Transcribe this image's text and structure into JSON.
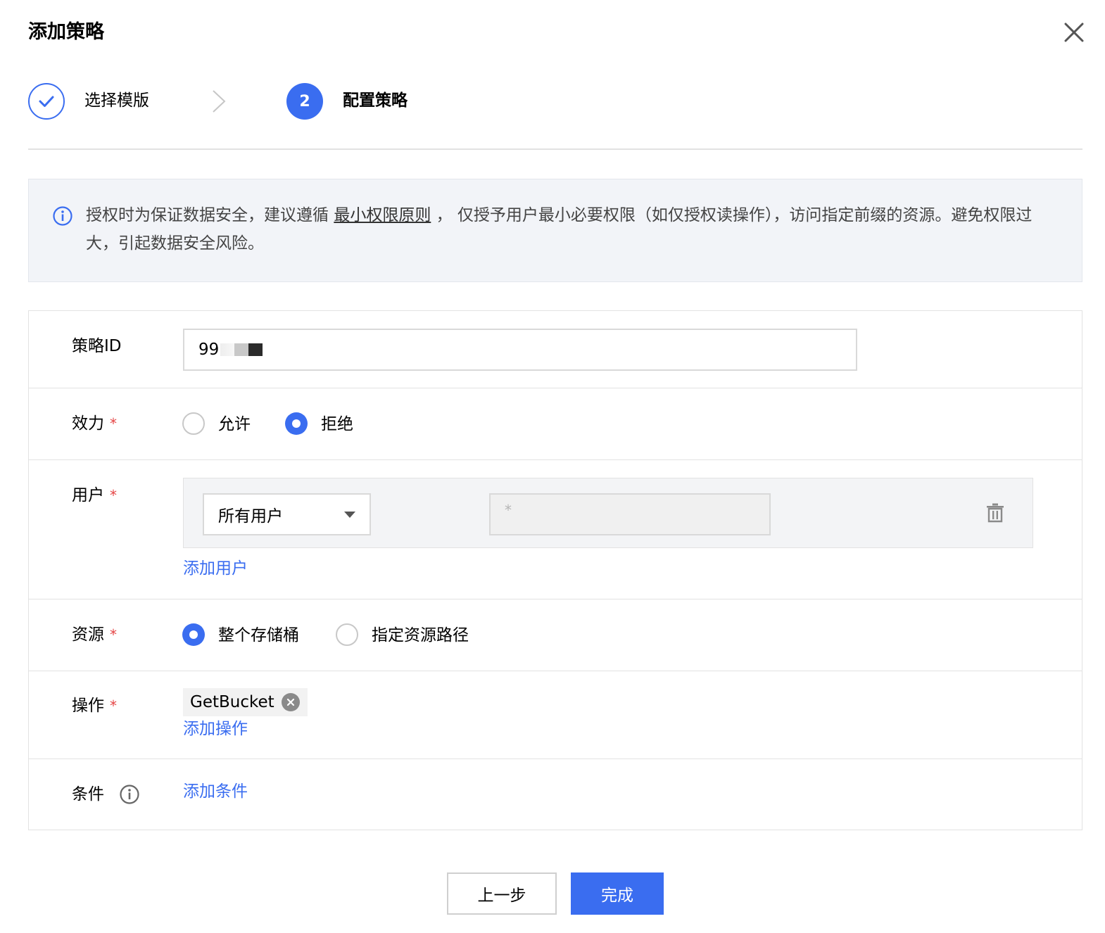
{
  "dialog": {
    "title": "添加策略"
  },
  "steps": [
    {
      "label": "选择模版",
      "status": "done"
    },
    {
      "number": "2",
      "label": "配置策略",
      "status": "active"
    }
  ],
  "notice": {
    "text_before": "授权时为保证数据安全，建议遵循 ",
    "link": "最小权限原则",
    "text_after": " ， 仅授予用户最小必要权限（如仅授权读操作），访问指定前缀的资源。避免权限过大，引起数据安全风险。"
  },
  "form": {
    "policy_id": {
      "label": "策略ID",
      "value": "99"
    },
    "effect": {
      "label": "效力",
      "required_mark": "*",
      "options": [
        "允许",
        "拒绝"
      ],
      "selected": "拒绝"
    },
    "users": {
      "label": "用户",
      "required_mark": "*",
      "select_value": "所有用户",
      "value_placeholder": "*",
      "add_link": "添加用户"
    },
    "resource": {
      "label": "资源",
      "required_mark": "*",
      "options": [
        "整个存储桶",
        "指定资源路径"
      ],
      "selected": "整个存储桶"
    },
    "actions": {
      "label": "操作",
      "required_mark": "*",
      "tags": [
        "GetBucket"
      ],
      "add_link": "添加操作"
    },
    "conditions": {
      "label": "条件",
      "add_link": "添加条件"
    }
  },
  "buttons": {
    "prev": "上一步",
    "done": "完成"
  },
  "colors": {
    "primary": "#3a6df0",
    "required": "#e54545",
    "notice_bg": "#f2f4f8"
  }
}
